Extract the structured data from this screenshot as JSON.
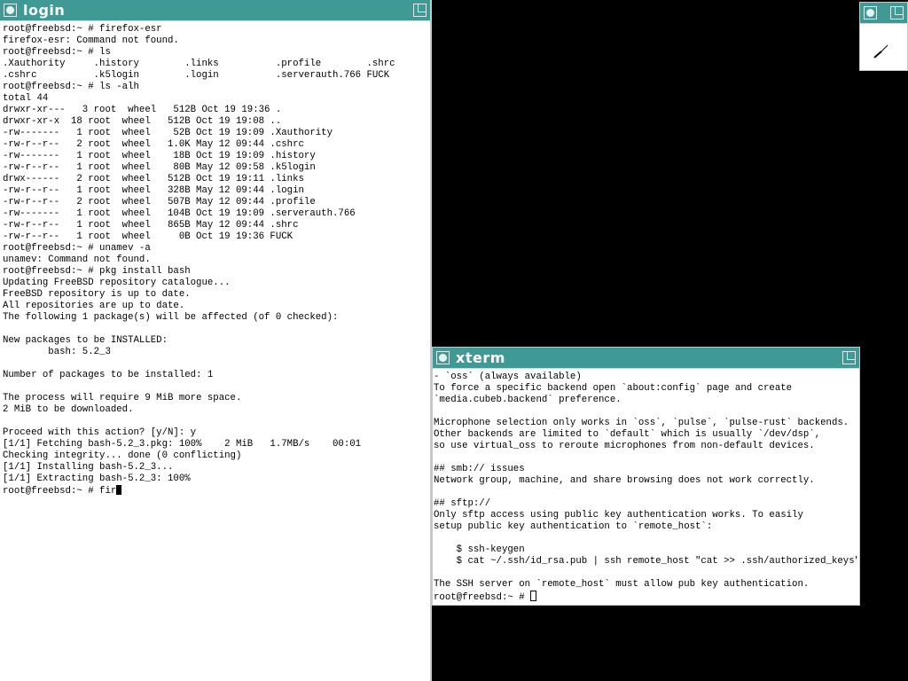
{
  "login": {
    "title": "login",
    "lines": [
      "root@freebsd:~ # firefox-esr",
      "firefox-esr: Command not found.",
      "root@freebsd:~ # ls",
      ".Xauthority     .history        .links          .profile        .shrc",
      ".cshrc          .k5login        .login          .serverauth.766 FUCK",
      "root@freebsd:~ # ls -alh",
      "total 44",
      "drwxr-xr---   3 root  wheel   512B Oct 19 19:36 .",
      "drwxr-xr-x  18 root  wheel   512B Oct 19 19:08 ..",
      "-rw-------   1 root  wheel    52B Oct 19 19:09 .Xauthority",
      "-rw-r--r--   2 root  wheel   1.0K May 12 09:44 .cshrc",
      "-rw-------   1 root  wheel    18B Oct 19 19:09 .history",
      "-rw-r--r--   1 root  wheel    80B May 12 09:58 .k5login",
      "drwx------   2 root  wheel   512B Oct 19 19:11 .links",
      "-rw-r--r--   1 root  wheel   328B May 12 09:44 .login",
      "-rw-r--r--   2 root  wheel   507B May 12 09:44 .profile",
      "-rw-------   1 root  wheel   104B Oct 19 19:09 .serverauth.766",
      "-rw-r--r--   1 root  wheel   865B May 12 09:44 .shrc",
      "-rw-r--r--   1 root  wheel     0B Oct 19 19:36 FUCK",
      "root@freebsd:~ # unamev -a",
      "unamev: Command not found.",
      "root@freebsd:~ # pkg install bash",
      "Updating FreeBSD repository catalogue...",
      "FreeBSD repository is up to date.",
      "All repositories are up to date.",
      "The following 1 package(s) will be affected (of 0 checked):",
      "",
      "New packages to be INSTALLED:",
      "        bash: 5.2_3",
      "",
      "Number of packages to be installed: 1",
      "",
      "The process will require 9 MiB more space.",
      "2 MiB to be downloaded.",
      "",
      "Proceed with this action? [y/N]: y",
      "[1/1] Fetching bash-5.2_3.pkg: 100%    2 MiB   1.7MB/s    00:01",
      "Checking integrity... done (0 conflicting)",
      "[1/1] Installing bash-5.2_3...",
      "[1/1] Extracting bash-5.2_3: 100%"
    ],
    "prompt": "root@freebsd:~ # fir"
  },
  "xterm": {
    "title": "xterm",
    "lines": [
      "- `oss` (always available)",
      "To force a specific backend open `about:config` page and create",
      "`media.cubeb.backend` preference.",
      "",
      "Microphone selection only works in `oss`, `pulse`, `pulse-rust` backends.",
      "Other backends are limited to `default` which is usually `/dev/dsp`,",
      "so use virtual_oss to reroute microphones from non-default devices.",
      "",
      "## smb:// issues",
      "Network group, machine, and share browsing does not work correctly.",
      "",
      "## sftp://",
      "Only sftp access using public key authentication works. To easily",
      "setup public key authentication to `remote_host`:",
      "",
      "    $ ssh-keygen",
      "    $ cat ~/.ssh/id_rsa.pub | ssh remote_host \"cat >> .ssh/authorized_keys\"",
      "",
      "The SSH server on `remote_host` must allow pub key authentication."
    ],
    "prompt": "root@freebsd:~ # "
  },
  "clock": {
    "icon": "analog-clock-icon"
  },
  "colors": {
    "titlebar": "#3f9a95",
    "desktop": "#000000",
    "window_bg": "#ffffff"
  }
}
